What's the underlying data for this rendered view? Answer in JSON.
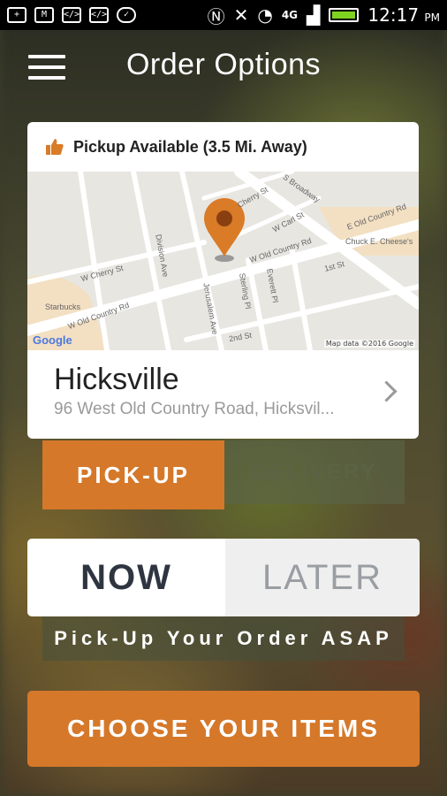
{
  "status_bar": {
    "icons": [
      "plus-icon",
      "mail-icon",
      "code-icon",
      "code-icon",
      "chat-icon",
      "nfc-icon",
      "mute-icon",
      "wifi-icon",
      "4g-lte-icon",
      "signal-icon",
      "battery-icon"
    ],
    "network": "4G",
    "time": "12:17",
    "ampm": "PM"
  },
  "header": {
    "title": "Order Options"
  },
  "card": {
    "pickup_text": "Pickup Available (3.5 Mi. Away)",
    "map": {
      "labels": [
        "Cherry St",
        "S Broadway",
        "W Carl St",
        "E Old Country Rd",
        "Chuck E. Cheese's",
        "W Cherry St",
        "Division Ave",
        "W Old Country Rd",
        "1st St",
        "Starbucks",
        "W Old Country Rd",
        "Jerusalem Ave",
        "Sterling Pl",
        "Everett Pl",
        "2nd St"
      ],
      "google": "Google",
      "mapdata": "Map data ©2016 Google"
    },
    "location_name": "Hicksville",
    "address": "96 West Old Country Road, Hicksvil..."
  },
  "method": {
    "pickup": "PICK-UP",
    "delivery": "DELIVERY",
    "selected": "PICK-UP"
  },
  "timing": {
    "now": "NOW",
    "later": "LATER",
    "selected": "NOW"
  },
  "asap_text": "Pick-Up Your Order ASAP",
  "cta": "CHOOSE YOUR ITEMS",
  "colors": {
    "accent": "#d5782a",
    "pin": "#d97b27"
  }
}
